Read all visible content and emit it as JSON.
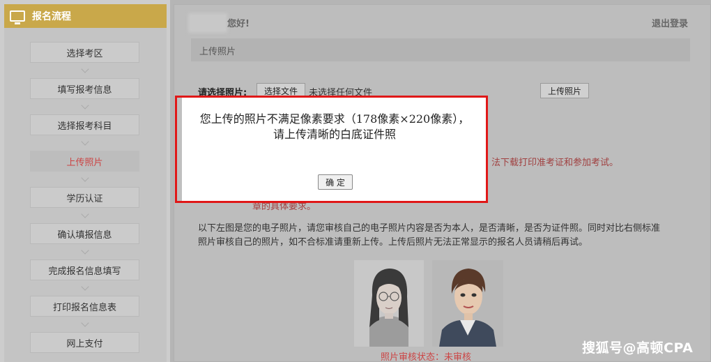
{
  "sidebar": {
    "title": "报名流程",
    "steps": [
      {
        "label": "选择考区"
      },
      {
        "label": "填写报考信息"
      },
      {
        "label": "选择报考科目"
      },
      {
        "label": "上传照片"
      },
      {
        "label": "学历认证"
      },
      {
        "label": "确认填报信息"
      },
      {
        "label": "完成报名信息填写"
      },
      {
        "label": "打印报名信息表"
      },
      {
        "label": "网上支付"
      }
    ],
    "active_step": "上传照片"
  },
  "header": {
    "greeting": "您好!",
    "logout": "退出登录"
  },
  "section": {
    "title": "上传照片"
  },
  "upload": {
    "label": "请选择照片:",
    "choose_button": "选择文件",
    "file_status": "未选择任何文件",
    "upload_button": "上传照片"
  },
  "notes": {
    "red_1": "法下载打印准考证和参加考试。",
    "red_2": "章的具体要求。",
    "intro": "以下左图是您的电子照片，请您审核自己的电子照片内容是否为本人，是否清晰，是否为证件照。同时对比右侧标准照片审核自己的照片，如不合标准请重新上传。上传后照片无法正常显示的报名人员请稍后再试。"
  },
  "review": {
    "status": "照片审核状态：未审核"
  },
  "modal": {
    "message": "您上传的照片不满足像素要求（178像素×220像素），请上传清晰的白底证件照",
    "ok_button": "确 定"
  },
  "watermark": "搜狐号@高顿CPA",
  "colors": {
    "header_gold": "#c9a84a",
    "active_red": "#c44444",
    "modal_border": "#e01818"
  }
}
